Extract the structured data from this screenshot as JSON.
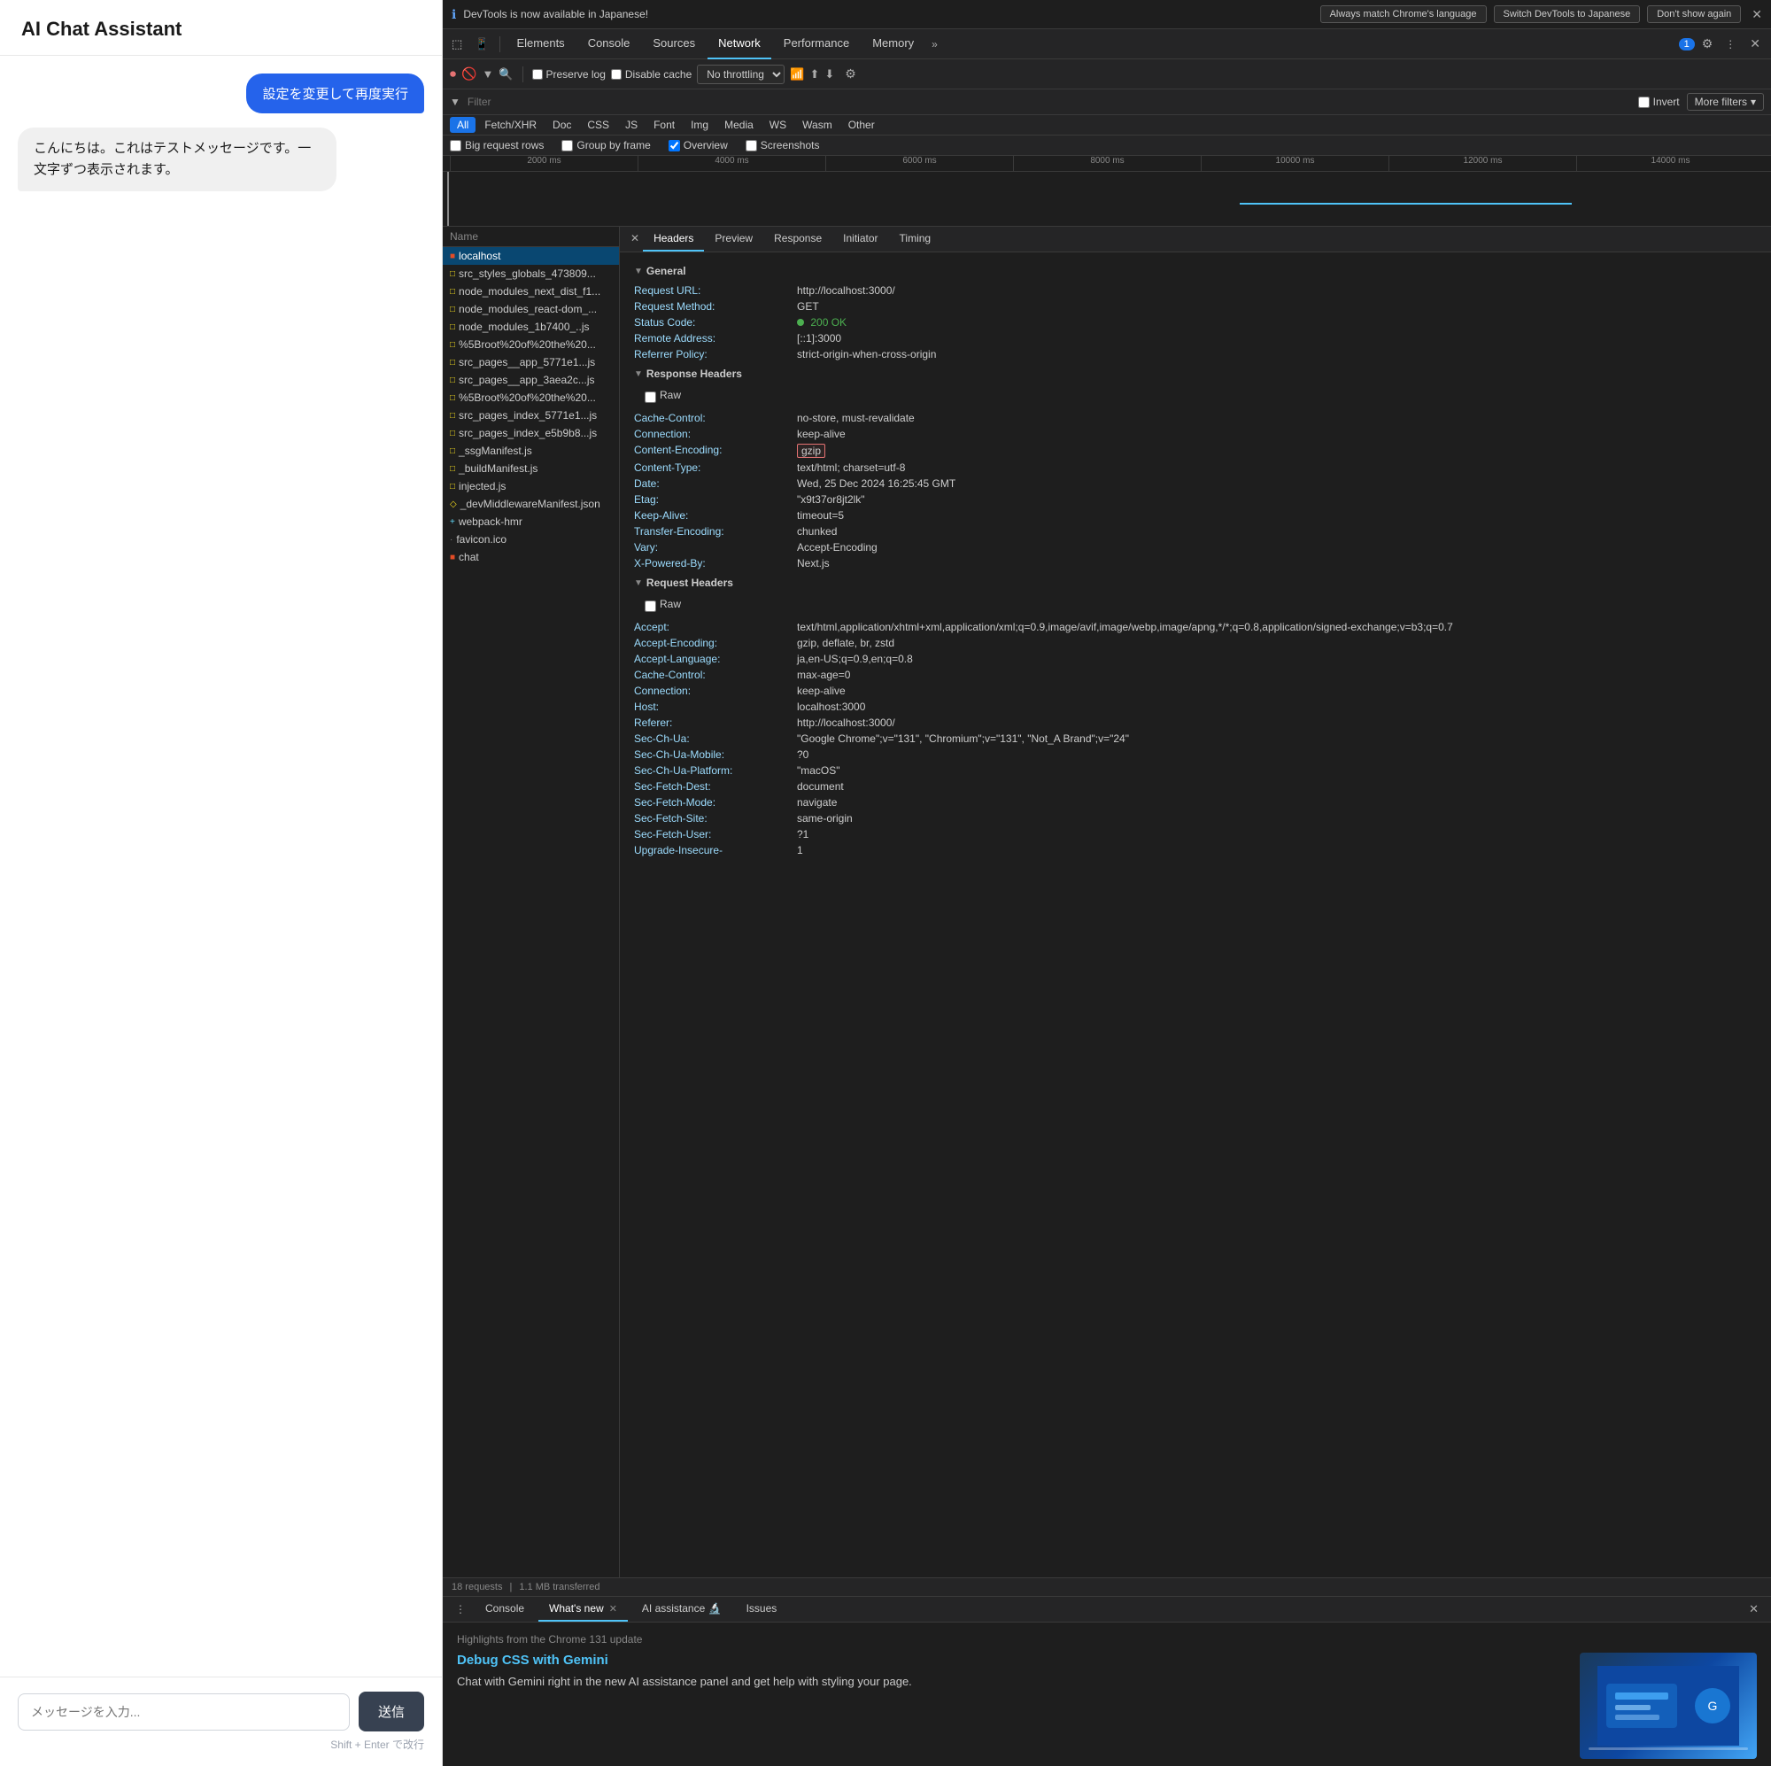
{
  "chat": {
    "title": "AI Chat Assistant",
    "messages": [
      {
        "type": "user",
        "text": "設定を変更して再度実行"
      },
      {
        "type": "assistant",
        "text": "こんにちは。これはテストメッセージです。一文字ずつ表示されます。"
      }
    ],
    "input_placeholder": "メッセージを入力...",
    "send_button": "送信",
    "input_hint": "Shift + Enter で改行"
  },
  "devtools": {
    "infobar": {
      "message": "DevTools is now available in Japanese!",
      "btn1": "Always match Chrome's language",
      "btn2": "Switch DevTools to Japanese",
      "btn3": "Don't show again"
    },
    "tabs": [
      "Elements",
      "Console",
      "Sources",
      "Network",
      "Performance",
      "Memory"
    ],
    "active_tab": "Network",
    "more_icon": "»",
    "badge": "1",
    "network": {
      "toolbar": {
        "preserve_log": "Preserve log",
        "disable_cache": "Disable cache",
        "no_throttle": "No throttling",
        "import_icon": "⬆",
        "export_icon": "⬇"
      },
      "filter_placeholder": "Filter",
      "invert_label": "Invert",
      "more_filters": "More filters",
      "type_filters": [
        "All",
        "Fetch/XHR",
        "Doc",
        "CSS",
        "JS",
        "Font",
        "Img",
        "Media",
        "WS",
        "Wasm",
        "Other"
      ],
      "active_type": "All",
      "options": {
        "big_request_rows": "Big request rows",
        "group_by_frame": "Group by frame",
        "overview": "Overview",
        "screenshots": "Screenshots"
      },
      "timeline": {
        "marks": [
          "2000 ms",
          "4000 ms",
          "6000 ms",
          "8000 ms",
          "10000 ms",
          "12000 ms",
          "14000 ms"
        ]
      }
    },
    "files": [
      {
        "name": "localhost",
        "type": "html",
        "selected": true
      },
      {
        "name": "src_styles_globals_473809...",
        "type": "js"
      },
      {
        "name": "node_modules_next_dist_f1...",
        "type": "js"
      },
      {
        "name": "node_modules_react-dom_...",
        "type": "js"
      },
      {
        "name": "node_modules_1b7400_..js",
        "type": "js"
      },
      {
        "name": "%5Broot%20of%20the%20...",
        "type": "js"
      },
      {
        "name": "src_pages__app_5771e1...js",
        "type": "js"
      },
      {
        "name": "src_pages__app_3aea2c...js",
        "type": "js"
      },
      {
        "name": "%5Broot%20of%20the%20...",
        "type": "js"
      },
      {
        "name": "src_pages_index_5771e1...js",
        "type": "js"
      },
      {
        "name": "src_pages_index_e5b9b8...js",
        "type": "js"
      },
      {
        "name": "_ssgManifest.js",
        "type": "js"
      },
      {
        "name": "_buildManifest.js",
        "type": "js"
      },
      {
        "name": "injected.js",
        "type": "js"
      },
      {
        "name": "_devMiddlewareManifest.json",
        "type": "json"
      },
      {
        "name": "webpack-hmr",
        "type": "hmr"
      },
      {
        "name": "favicon.ico",
        "type": "ico"
      },
      {
        "name": "chat",
        "type": "chat"
      }
    ],
    "headers": {
      "tabs": [
        "Headers",
        "Preview",
        "Response",
        "Initiator",
        "Timing"
      ],
      "active_tab": "Headers",
      "general": {
        "title": "General",
        "rows": [
          {
            "key": "Request URL:",
            "val": "http://localhost:3000/"
          },
          {
            "key": "Request Method:",
            "val": "GET"
          },
          {
            "key": "Status Code:",
            "val": "200 OK",
            "type": "status"
          },
          {
            "key": "Remote Address:",
            "val": "[::1]:3000"
          },
          {
            "key": "Referrer Policy:",
            "val": "strict-origin-when-cross-origin"
          }
        ]
      },
      "response_headers": {
        "title": "Response Headers",
        "rows": [
          {
            "key": "Cache-Control:",
            "val": "no-store, must-revalidate"
          },
          {
            "key": "Connection:",
            "val": "keep-alive"
          },
          {
            "key": "Content-Encoding:",
            "val": "gzip",
            "highlighted": true
          },
          {
            "key": "Content-Type:",
            "val": "text/html; charset=utf-8"
          },
          {
            "key": "Date:",
            "val": "Wed, 25 Dec 2024 16:25:45 GMT"
          },
          {
            "key": "Etag:",
            "val": "\"x9t37or8jt2lk\""
          },
          {
            "key": "Keep-Alive:",
            "val": "timeout=5"
          },
          {
            "key": "Transfer-Encoding:",
            "val": "chunked"
          },
          {
            "key": "Vary:",
            "val": "Accept-Encoding"
          },
          {
            "key": "X-Powered-By:",
            "val": "Next.js"
          }
        ]
      },
      "request_headers": {
        "title": "Request Headers",
        "rows": [
          {
            "key": "Accept:",
            "val": "text/html,application/xhtml+xml,application/xml;q=0.9,image/avif,image/webp,image/apng,*/*;q=0.8,application/signed-exchange;v=b3;q=0.7"
          },
          {
            "key": "Accept-Encoding:",
            "val": "gzip, deflate, br, zstd"
          },
          {
            "key": "Accept-Language:",
            "val": "ja,en-US;q=0.9,en;q=0.8"
          },
          {
            "key": "Cache-Control:",
            "val": "max-age=0"
          },
          {
            "key": "Connection:",
            "val": "keep-alive"
          },
          {
            "key": "Host:",
            "val": "localhost:3000"
          },
          {
            "key": "Referer:",
            "val": "http://localhost:3000/"
          },
          {
            "key": "Sec-Ch-Ua:",
            "val": "\"Google Chrome\";v=\"131\", \"Chromium\";v=\"131\", \"Not_A Brand\";v=\"24\""
          },
          {
            "key": "Sec-Ch-Ua-Mobile:",
            "val": "?0"
          },
          {
            "key": "Sec-Ch-Ua-Platform:",
            "val": "\"macOS\""
          },
          {
            "key": "Sec-Fetch-Dest:",
            "val": "document"
          },
          {
            "key": "Sec-Fetch-Mode:",
            "val": "navigate"
          },
          {
            "key": "Sec-Fetch-Site:",
            "val": "same-origin"
          },
          {
            "key": "Sec-Fetch-User:",
            "val": "?1"
          },
          {
            "key": "Upgrade-Insecure-",
            "val": "1"
          }
        ]
      }
    },
    "status_bar": {
      "requests": "18 requests",
      "transferred": "1.1 MB transferred"
    },
    "bottom_panel": {
      "tabs": [
        "Console",
        "What's new",
        "AI assistance 🔬",
        "Issues"
      ],
      "active_tab": "What's new",
      "highlights_title": "Highlights from the Chrome 131 update",
      "feature_title": "Debug CSS with Gemini",
      "feature_desc": "Chat with Gemini right in the new AI assistance panel and get help with styling your page."
    }
  }
}
